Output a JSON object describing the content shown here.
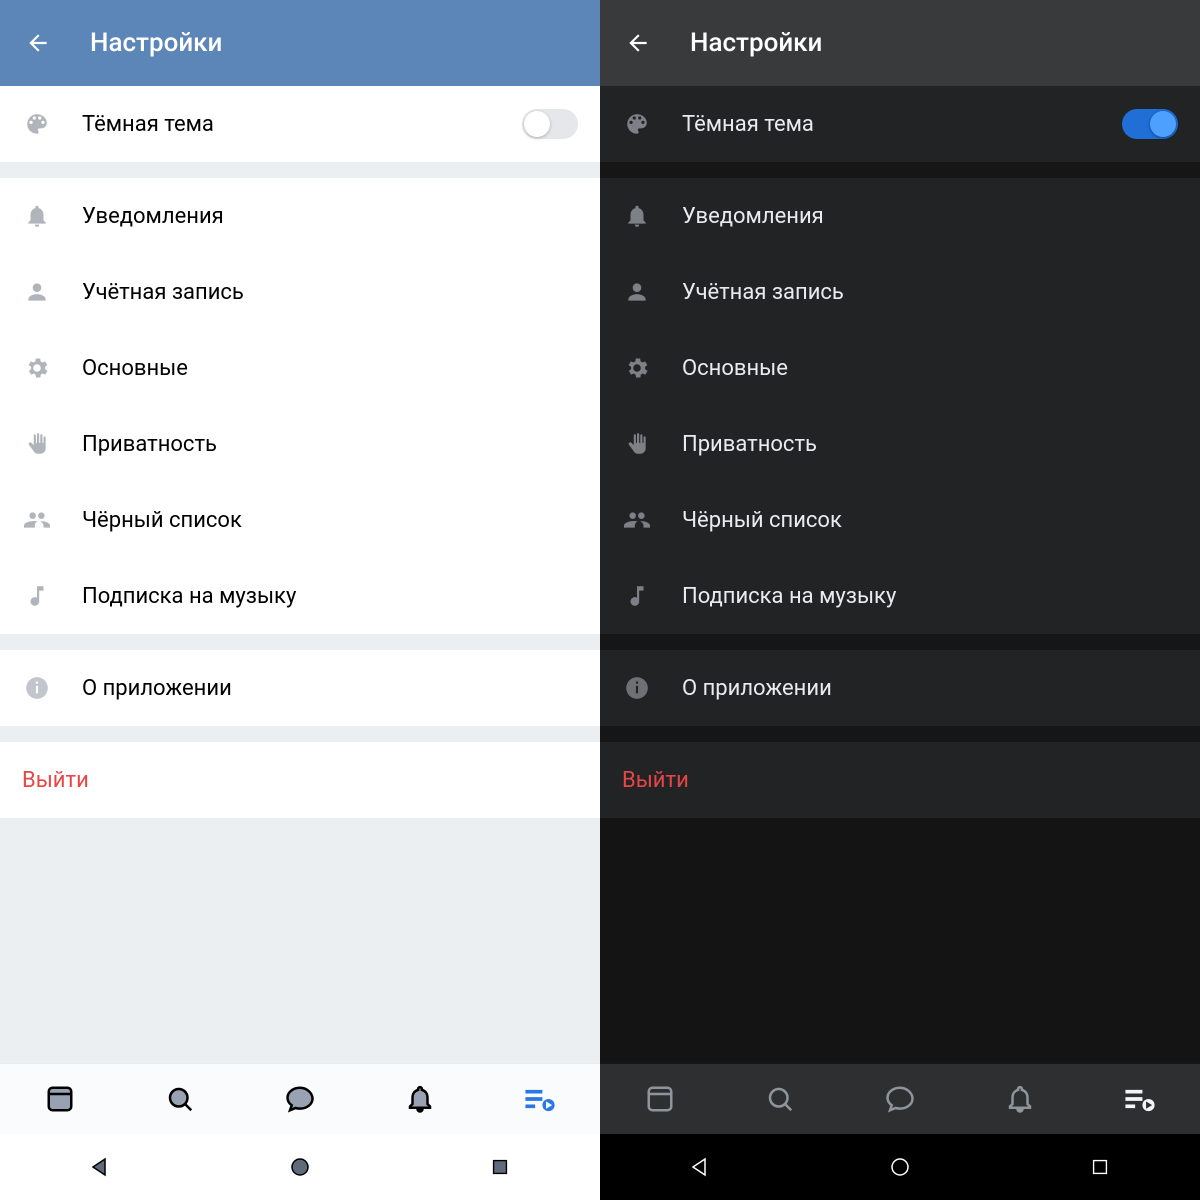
{
  "light": {
    "header": {
      "title": "Настройки"
    },
    "theme_row": {
      "label": "Тёмная тема",
      "toggle_on": false
    },
    "items": [
      {
        "icon": "bell-icon",
        "label": "Уведомления"
      },
      {
        "icon": "person-icon",
        "label": "Учётная запись"
      },
      {
        "icon": "gear-icon",
        "label": "Основные"
      },
      {
        "icon": "hand-icon",
        "label": "Приватность"
      },
      {
        "icon": "group-icon",
        "label": "Чёрный список"
      },
      {
        "icon": "music-icon",
        "label": "Подписка на музыку"
      }
    ],
    "about": {
      "label": "О приложении"
    },
    "logout": {
      "label": "Выйти"
    }
  },
  "dark": {
    "header": {
      "title": "Настройки"
    },
    "theme_row": {
      "label": "Тёмная тема",
      "toggle_on": true
    },
    "items": [
      {
        "icon": "bell-icon",
        "label": "Уведомления"
      },
      {
        "icon": "person-icon",
        "label": "Учётная запись"
      },
      {
        "icon": "gear-icon",
        "label": "Основные"
      },
      {
        "icon": "hand-icon",
        "label": "Приватность"
      },
      {
        "icon": "group-icon",
        "label": "Чёрный список"
      },
      {
        "icon": "music-icon",
        "label": "Подписка на музыку"
      }
    ],
    "about": {
      "label": "О приложении"
    },
    "logout": {
      "label": "Выйти"
    }
  },
  "colors": {
    "light_header": "#5b86b7",
    "dark_header": "#393a3c",
    "accent_blue": "#2a79e2",
    "logout_red": "#e64646"
  }
}
